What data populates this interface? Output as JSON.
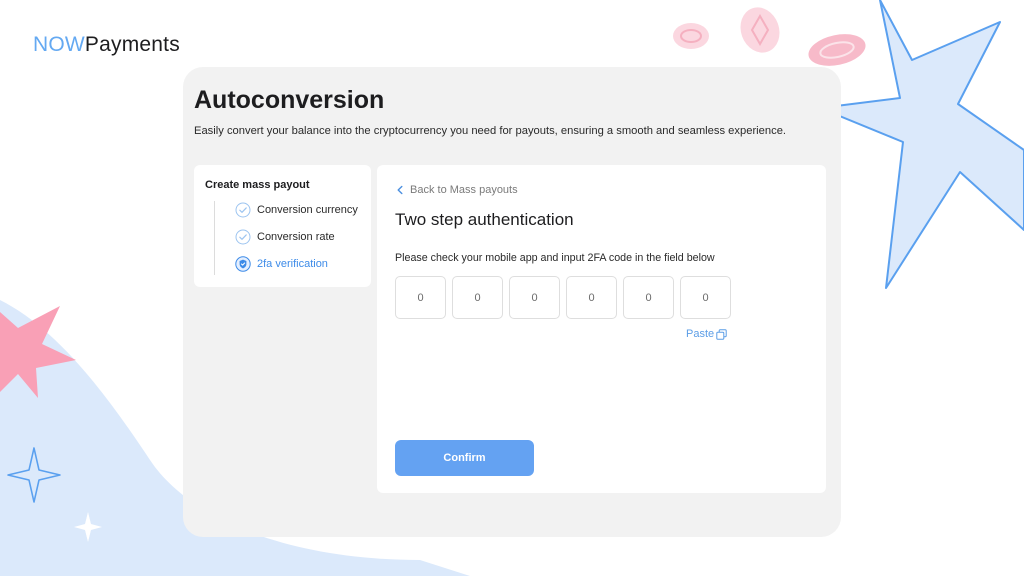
{
  "brand": {
    "logo_now": "NOW",
    "logo_payments": "Payments",
    "accent": "#64a9f2"
  },
  "header": {
    "title": "Autoconversion",
    "subtitle": "Easily convert your balance into the cryptocurrency you need for payouts, ensuring a smooth and seamless experience."
  },
  "steps": {
    "title": "Create mass payout",
    "items": [
      {
        "label": "Conversion currency",
        "icon": "check-circle-icon",
        "state": "done"
      },
      {
        "label": "Conversion rate",
        "icon": "check-circle-icon",
        "state": "done"
      },
      {
        "label": "2fa verification",
        "icon": "shield-icon",
        "state": "active"
      }
    ]
  },
  "main": {
    "back_label": "Back to Mass payouts",
    "title": "Two step authentication",
    "instructions": "Please check your mobile app and input 2FA code in the field below",
    "code_digits": [
      "0",
      "0",
      "0",
      "0",
      "0",
      "0"
    ],
    "paste_label": "Paste",
    "confirm_label": "Confirm"
  },
  "colors": {
    "button": "#64a2f2",
    "link": "#5b9de6",
    "active_step": "#3d8be8",
    "decor_pink": "#f9a0b6",
    "decor_blue": "#dbe9fb"
  }
}
